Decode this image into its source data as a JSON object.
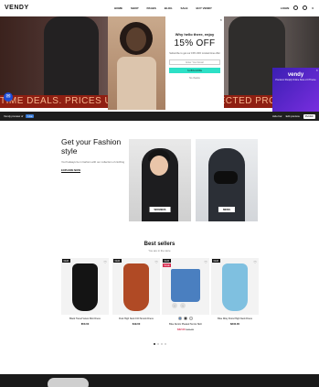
{
  "header": {
    "logo": "VENDY",
    "nav": [
      "HOME",
      "SHOP",
      "PAGES",
      "BLOG",
      "SALE",
      "BUY VENDY"
    ],
    "login": "LOGIN",
    "cart_count": "0"
  },
  "hero": {
    "ticker": "TIME DEALS. PRICES UP TO 50% OFF ON SELECTED PRODUCTS. LIMITED TIME"
  },
  "popup": {
    "close": "×",
    "hello": "Why hello there, enjoy",
    "offer": "15% OFF",
    "description": "Subscribe to get our 15% OFF Limited time offer",
    "email_placeholder": "Enter Your Email",
    "button": "SUBSCRIBE",
    "no_thanks": "No thanks"
  },
  "chat": {
    "icon": "chat-icon"
  },
  "vendy_ad": {
    "title": "vendy",
    "subtitle": "Premium Shopify Online Store 2.0 Theme",
    "close": "×"
  },
  "admin_bar": {
    "text": "Vendy preview of",
    "badge": "Live",
    "view": "Hide bar",
    "edit": "Edit preview",
    "publish": "Publish"
  },
  "fashion": {
    "heading": "Get your Fashion style",
    "description": "You'll always be in fashion with our collection of clothing",
    "link": "EXPLORE NOW",
    "women_label": "WOMENS",
    "men_label": "MENS"
  },
  "best_sellers": {
    "title": "Best sellers",
    "subtitle": "You are in the store",
    "products": [
      {
        "tag": "NEW",
        "tag2": "",
        "name": "Black Tiered Velvet Mini Dress",
        "price": "$50.00",
        "old_price": "",
        "color": "#141414"
      },
      {
        "tag": "NEW",
        "tag2": "",
        "name": "Rust High Neck Frill Smock Dress",
        "price": "$49.00",
        "old_price": "",
        "color": "#b04a25"
      },
      {
        "tag": "NEW",
        "tag2": "SALE",
        "name": "Blue Denim Pleated Tennis Skirt",
        "price": "$32.00",
        "old_price": "$40.00",
        "color": "#4a7fc0"
      },
      {
        "tag": "NEW",
        "tag2": "",
        "name": "Blue Ditsy Floral High Neck Dress",
        "price": "$240.00",
        "old_price": "",
        "color": "#7fc0e0"
      }
    ]
  }
}
